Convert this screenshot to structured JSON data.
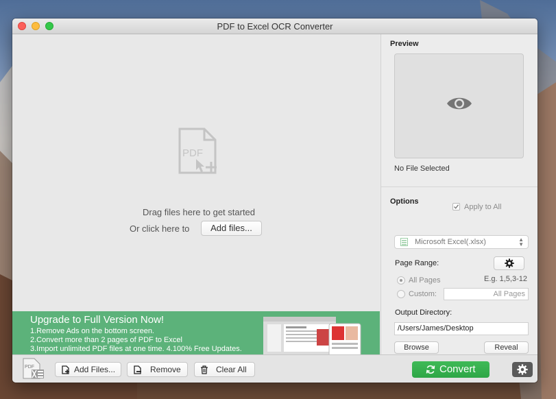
{
  "window": {
    "title": "PDF to Excel OCR Converter"
  },
  "dropzone": {
    "drag_text": "Drag files here to get started",
    "click_text": "Or click here to",
    "add_files_button": "Add files..."
  },
  "banner": {
    "heading": "Upgrade to Full Version Now!",
    "lines": [
      "1.Remove Ads on the bottom screen.",
      "2.Convert more than 2 pages of PDF to Excel",
      "3.Import unlimited PDF files at one time. 4.100% Free Updates."
    ],
    "icon_pdf": "PDF",
    "icon_excel": "Excel"
  },
  "preview": {
    "title": "Preview",
    "status": "No File Selected",
    "icon": "eye-icon"
  },
  "options": {
    "title": "Options",
    "apply_to_all": {
      "label": "Apply to All",
      "checked": true
    },
    "format": {
      "selected": "Microsoft Excel(.xlsx)"
    },
    "page_range": {
      "label": "Page Range:",
      "example": "E.g. 1,5,3-12",
      "all_pages_label": "All Pages",
      "custom_label": "Custom:",
      "custom_placeholder": "All Pages",
      "selected": "all"
    },
    "output": {
      "label": "Output Directory:",
      "path": "/Users/James/Desktop",
      "browse": "Browse",
      "reveal": "Reveal"
    }
  },
  "bottom_bar": {
    "add_files": "Add Files...",
    "remove": "Remove",
    "clear_all": "Clear All",
    "convert": "Convert",
    "app_icon_text": "PDF"
  },
  "colors": {
    "banner_green": "#5cb27a",
    "convert_green": "#36b04f",
    "close_red": "#fc605b",
    "minimize_yellow": "#fdbc40",
    "maximize_green": "#34c84a"
  }
}
